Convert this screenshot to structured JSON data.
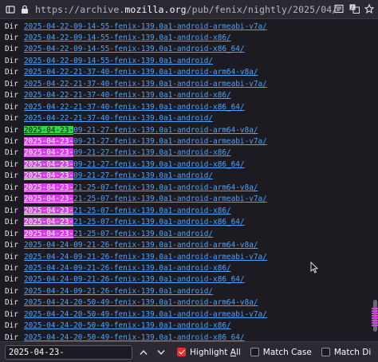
{
  "urlbar": {
    "url_prefix": "https://archive.",
    "url_domain": "mozilla.org",
    "url_path": "/pub/fenix/nightly/2025/04/",
    "icons": [
      "panel-toggle-icon",
      "lock-icon",
      "reader-view-icon",
      "translate-icon",
      "bookmark-icon"
    ]
  },
  "listing": {
    "rows": [
      {
        "kind": "Dir",
        "hl": "",
        "hl_type": "",
        "rest": "2025-04-22-09-14-55-fenix-139.0a1-android-armeabi-v7a/"
      },
      {
        "kind": "Dir",
        "hl": "",
        "hl_type": "",
        "rest": "2025-04-22-09-14-55-fenix-139.0a1-android-x86/"
      },
      {
        "kind": "Dir",
        "hl": "",
        "hl_type": "",
        "rest": "2025-04-22-09-14-55-fenix-139.0a1-android-x86_64/"
      },
      {
        "kind": "Dir",
        "hl": "",
        "hl_type": "",
        "rest": "2025-04-22-09-14-55-fenix-139.0a1-android/"
      },
      {
        "kind": "Dir",
        "hl": "",
        "hl_type": "",
        "rest": "2025-04-22-21-37-40-fenix-139.0a1-android-arm64-v8a/"
      },
      {
        "kind": "Dir",
        "hl": "",
        "hl_type": "",
        "rest": "2025-04-22-21-37-40-fenix-139.0a1-android-armeabi-v7a/"
      },
      {
        "kind": "Dir",
        "hl": "",
        "hl_type": "",
        "rest": "2025-04-22-21-37-40-fenix-139.0a1-android-x86/"
      },
      {
        "kind": "Dir",
        "hl": "",
        "hl_type": "",
        "rest": "2025-04-22-21-37-40-fenix-139.0a1-android-x86_64/"
      },
      {
        "kind": "Dir",
        "hl": "",
        "hl_type": "",
        "rest": "2025-04-22-21-37-40-fenix-139.0a1-android/"
      },
      {
        "kind": "Dir",
        "hl": "2025-04-23-",
        "hl_type": "active",
        "rest": "09-21-27-fenix-139.0a1-android-arm64-v8a/"
      },
      {
        "kind": "Dir",
        "hl": "2025-04-23-",
        "hl_type": "match",
        "rest": "09-21-27-fenix-139.0a1-android-armeabi-v7a/"
      },
      {
        "kind": "Dir",
        "hl": "2025-04-23-",
        "hl_type": "match",
        "rest": "09-21-27-fenix-139.0a1-android-x86/"
      },
      {
        "kind": "Dir",
        "hl": "2025-04-23-",
        "hl_type": "match",
        "rest": "09-21-27-fenix-139.0a1-android-x86_64/"
      },
      {
        "kind": "Dir",
        "hl": "2025-04-23-",
        "hl_type": "match",
        "rest": "09-21-27-fenix-139.0a1-android/"
      },
      {
        "kind": "Dir",
        "hl": "2025-04-23-",
        "hl_type": "match",
        "rest": "21-25-07-fenix-139.0a1-android-arm64-v8a/"
      },
      {
        "kind": "Dir",
        "hl": "2025-04-23-",
        "hl_type": "match",
        "rest": "21-25-07-fenix-139.0a1-android-armeabi-v7a/"
      },
      {
        "kind": "Dir",
        "hl": "2025-04-23-",
        "hl_type": "match",
        "rest": "21-25-07-fenix-139.0a1-android-x86/"
      },
      {
        "kind": "Dir",
        "hl": "2025-04-23-",
        "hl_type": "match",
        "rest": "21-25-07-fenix-139.0a1-android-x86_64/"
      },
      {
        "kind": "Dir",
        "hl": "2025-04-23-",
        "hl_type": "match",
        "rest": "21-25-07-fenix-139.0a1-android/"
      },
      {
        "kind": "Dir",
        "hl": "",
        "hl_type": "",
        "rest": "2025-04-24-09-21-26-fenix-139.0a1-android-arm64-v8a/"
      },
      {
        "kind": "Dir",
        "hl": "",
        "hl_type": "",
        "rest": "2025-04-24-09-21-26-fenix-139.0a1-android-armeabi-v7a/"
      },
      {
        "kind": "Dir",
        "hl": "",
        "hl_type": "",
        "rest": "2025-04-24-09-21-26-fenix-139.0a1-android-x86/"
      },
      {
        "kind": "Dir",
        "hl": "",
        "hl_type": "",
        "rest": "2025-04-24-09-21-26-fenix-139.0a1-android-x86_64/"
      },
      {
        "kind": "Dir",
        "hl": "",
        "hl_type": "",
        "rest": "2025-04-24-09-21-26-fenix-139.0a1-android/"
      },
      {
        "kind": "Dir",
        "hl": "",
        "hl_type": "",
        "rest": "2025-04-24-20-50-49-fenix-139.0a1-android-arm64-v8a/"
      },
      {
        "kind": "Dir",
        "hl": "",
        "hl_type": "",
        "rest": "2025-04-24-20-50-49-fenix-139.0a1-android-armeabi-v7a/"
      },
      {
        "kind": "Dir",
        "hl": "",
        "hl_type": "",
        "rest": "2025-04-24-20-50-49-fenix-139.0a1-android-x86/"
      },
      {
        "kind": "Dir",
        "hl": "",
        "hl_type": "",
        "rest": "2025-04-24-20-50-49-fenix-139.0a1-android-x86_64/"
      }
    ]
  },
  "findbar": {
    "query": "2025-04-23-",
    "highlight_all_label": "Highlight ",
    "highlight_all_key": "A",
    "highlight_all_rest": "ll",
    "highlight_all_checked": true,
    "match_case_label": "Match Case",
    "match_diacritics_label": "Match Di",
    "match_case_checked": false,
    "match_diacritics_checked": false
  },
  "colors": {
    "background": "#1c1b22",
    "link": "#4aa3ff",
    "active_match": "#35d34b",
    "match": "#d63fe6",
    "checkbox_checked": "#e4312d"
  }
}
